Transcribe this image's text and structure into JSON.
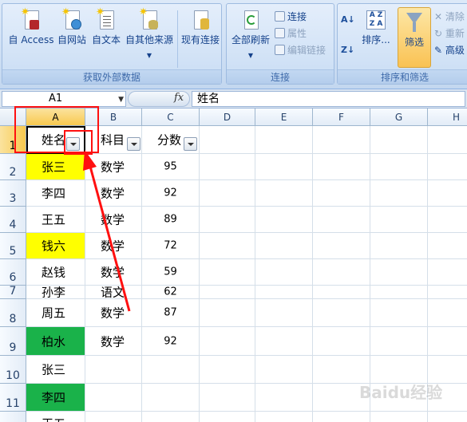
{
  "ribbon": {
    "get_external_data": {
      "label": "获取外部数据",
      "buttons": [
        "自 Access",
        "自网站",
        "自文本",
        "自其他来源"
      ],
      "existing_connections": "现有连接"
    },
    "connections": {
      "label": "连接",
      "refresh_all": "全部刷新",
      "connections": "连接",
      "properties": "属性",
      "edit_links": "编辑链接"
    },
    "sort_filter": {
      "label": "排序和筛选",
      "sort": "排序...",
      "filter": "筛选",
      "clear": "清除",
      "reapply": "重新",
      "advanced": "高级"
    }
  },
  "formula_bar": {
    "name_box": "A1",
    "fx": "fx",
    "content": "姓名"
  },
  "columns": [
    "A",
    "B",
    "C",
    "D",
    "E",
    "F",
    "G",
    "H"
  ],
  "rows": [
    "1",
    "2",
    "3",
    "4",
    "5",
    "6",
    "7",
    "8",
    "9",
    "10",
    "11",
    ""
  ],
  "header": {
    "name": "姓名",
    "subject": "科目",
    "score": "分数"
  },
  "data": [
    {
      "name": "张三",
      "subject": "数学",
      "score": "95",
      "fill": "yellow"
    },
    {
      "name": "李四",
      "subject": "数学",
      "score": "92",
      "fill": ""
    },
    {
      "name": "王五",
      "subject": "数学",
      "score": "89",
      "fill": ""
    },
    {
      "name": "钱六",
      "subject": "数学",
      "score": "72",
      "fill": "yellow"
    },
    {
      "name": "赵钱",
      "subject": "数学",
      "score": "59",
      "fill": ""
    },
    {
      "name": "孙李",
      "subject": "语文",
      "score": "62",
      "fill": ""
    },
    {
      "name": "周五",
      "subject": "数学",
      "score": "87",
      "fill": ""
    },
    {
      "name": "柏水",
      "subject": "数学",
      "score": "92",
      "fill": "green"
    },
    {
      "name": "张三",
      "subject": "",
      "score": "",
      "fill": ""
    },
    {
      "name": "李四",
      "subject": "",
      "score": "",
      "fill": "green"
    },
    {
      "name": "王五",
      "subject": "",
      "score": "",
      "fill": ""
    }
  ],
  "colors": {
    "yellow": "#ffff00",
    "green": "#1ab24a",
    "annotation_red": "#ff1010"
  },
  "watermark": "Baidu经验"
}
